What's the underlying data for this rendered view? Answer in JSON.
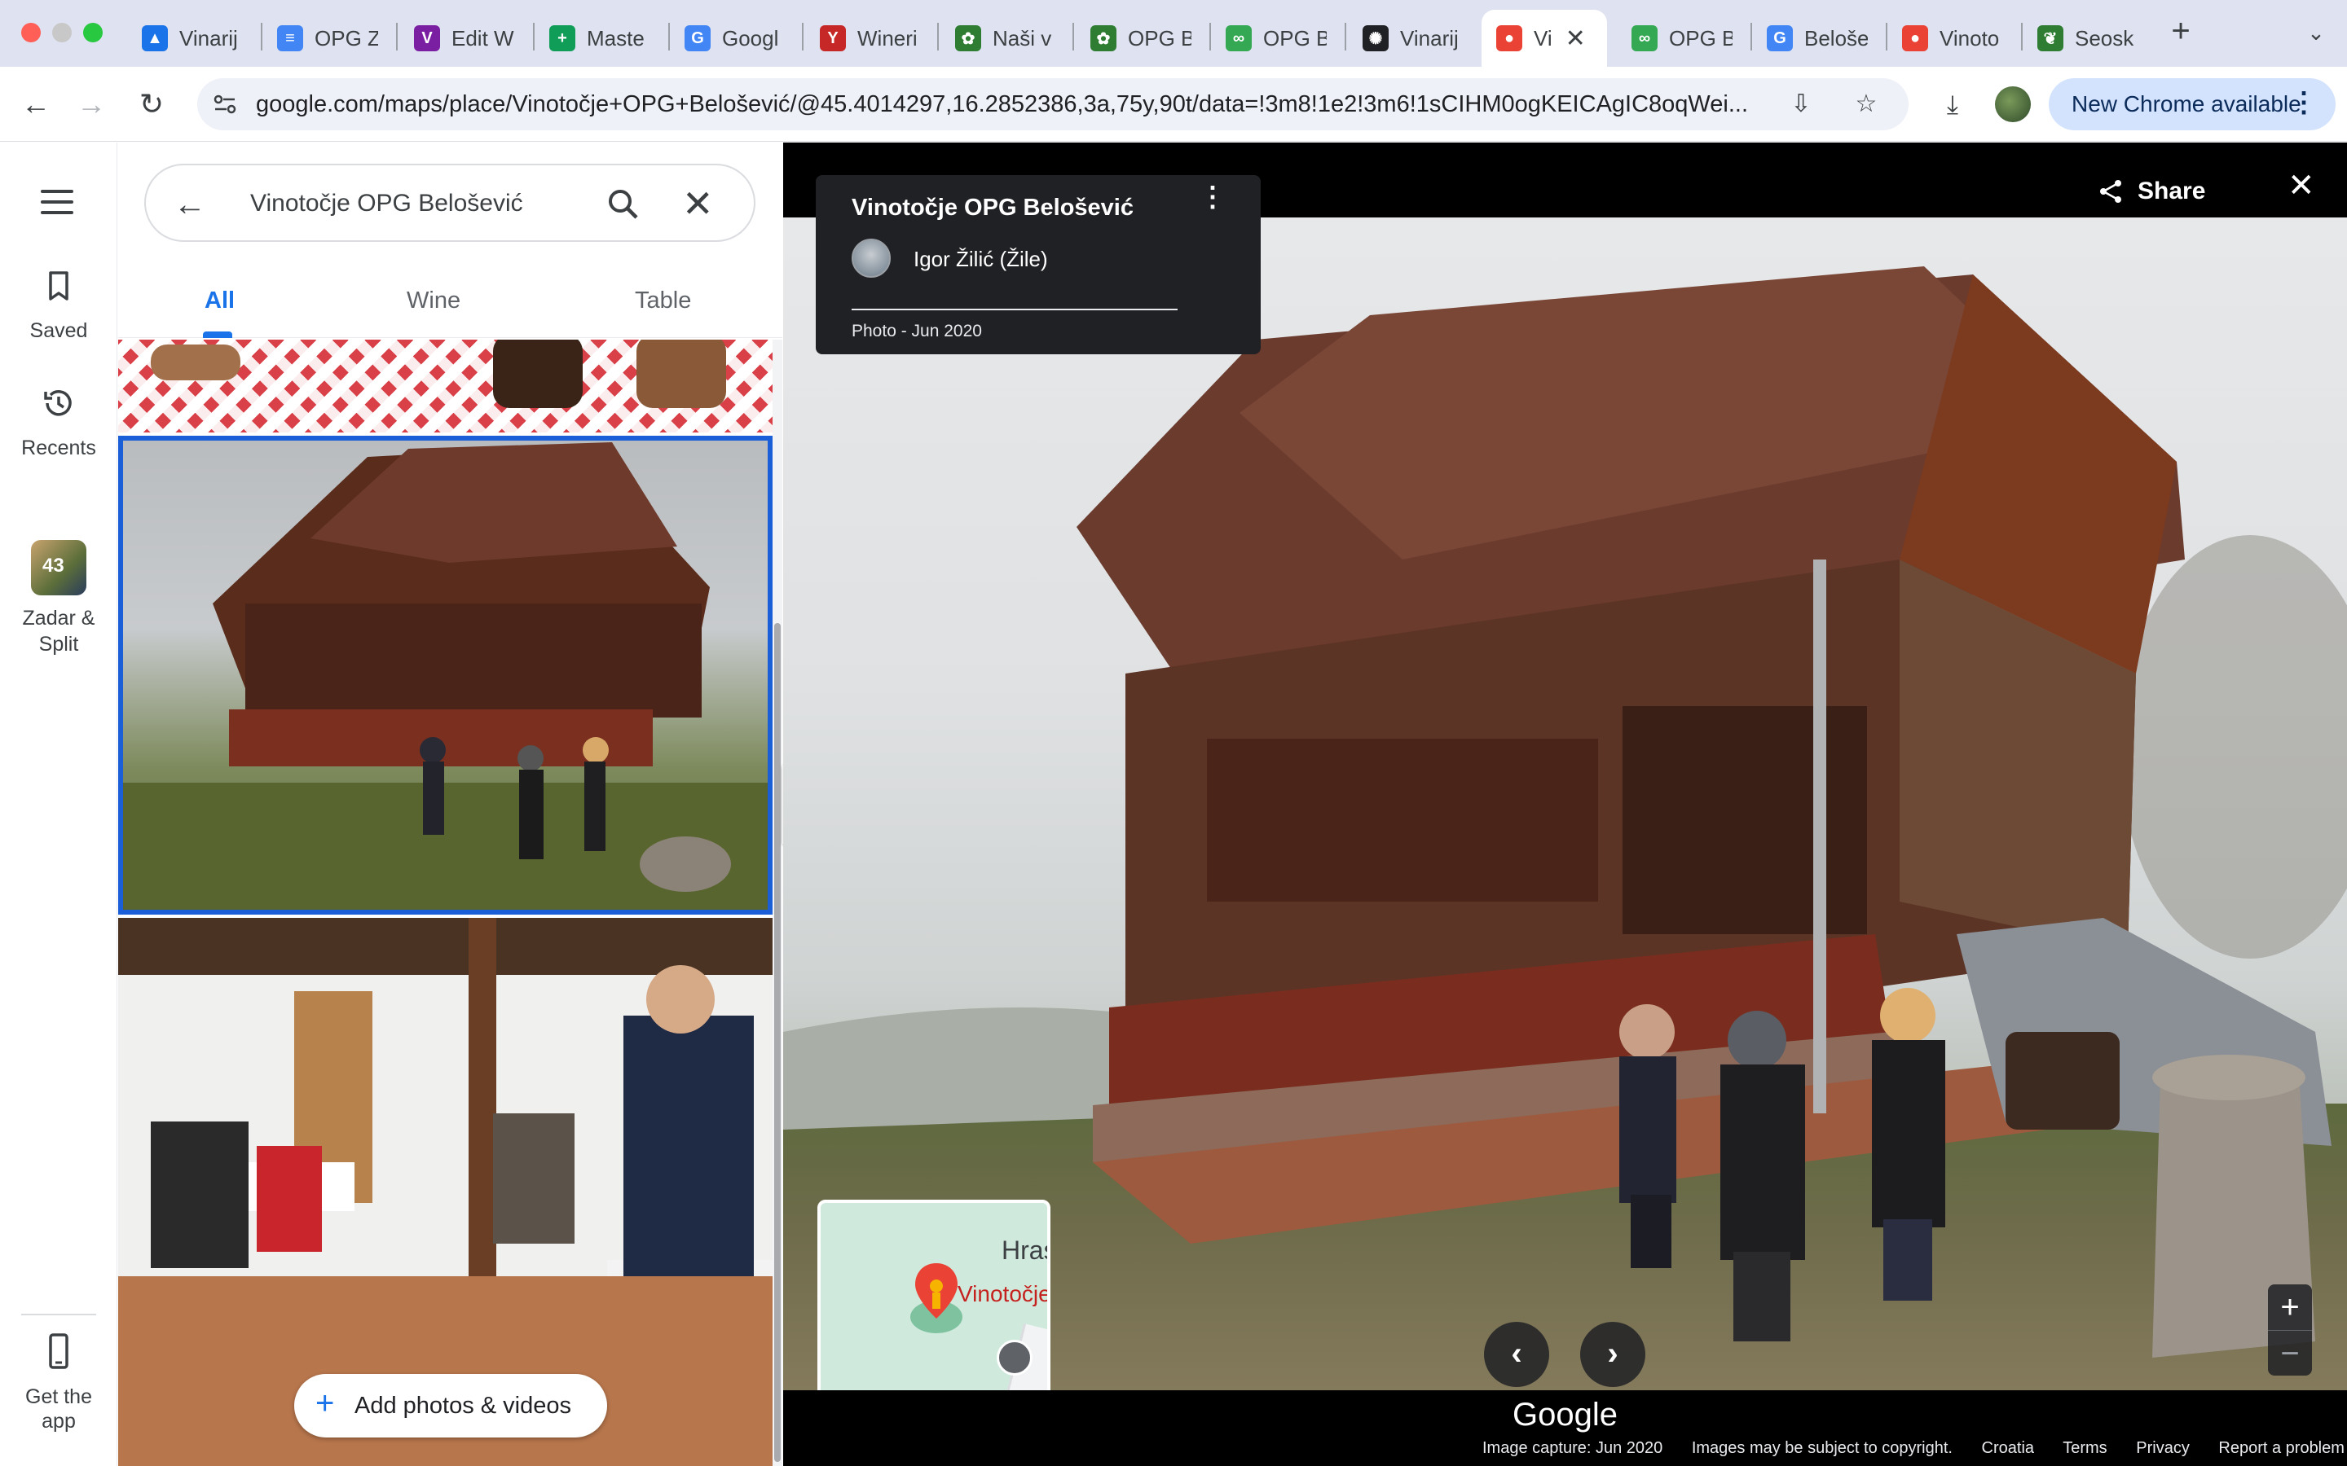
{
  "browser": {
    "tabs": [
      {
        "title": "Vinarij",
        "icon": "google-drive-icon",
        "color": "#1a73e8"
      },
      {
        "title": "OPG Z",
        "icon": "google-docs-icon",
        "color": "#4285f4"
      },
      {
        "title": "Edit W",
        "icon": "site-logo-icon",
        "color": "#7b1fa2"
      },
      {
        "title": "Maste",
        "icon": "google-sheets-icon",
        "color": "#0f9d58"
      },
      {
        "title": "Googl",
        "icon": "google-translate-icon",
        "color": "#4285f4"
      },
      {
        "title": "Wineri",
        "icon": "wine-glass-icon",
        "color": "#c62828"
      },
      {
        "title": "Naši v",
        "icon": "grape-icon",
        "color": "#2e7d32"
      },
      {
        "title": "OPG B",
        "icon": "grape-icon",
        "color": "#2e7d32"
      },
      {
        "title": "OPG B",
        "icon": "tripadvisor-icon",
        "color": "#34a853"
      },
      {
        "title": "Vinarij",
        "icon": "openai-icon",
        "color": "#202124"
      },
      {
        "title": "Vi",
        "icon": "google-maps-icon",
        "color": "#ea4335",
        "active": true
      },
      {
        "title": "OPG B",
        "icon": "tripadvisor-icon",
        "color": "#34a853"
      },
      {
        "title": "Belošev",
        "icon": "google-g-icon",
        "color": "#4285f4"
      },
      {
        "title": "Vinoto",
        "icon": "google-maps-icon",
        "color": "#ea4335"
      },
      {
        "title": "Seosk",
        "icon": "leaf-icon",
        "color": "#2e7d32"
      }
    ],
    "url": "google.com/maps/place/Vinotočje+OPG+Belošević/@45.4014297,16.2852386,3a,75y,90t/data=!3m8!1e2!3m6!1sCIHM0ogKEICAgIC8oqWei...",
    "update_label": "New Chrome available"
  },
  "rail": {
    "saved": "Saved",
    "recents": "Recents",
    "list_count": "43",
    "list_name": "Zadar & Split",
    "get_app": "Get the app"
  },
  "panel": {
    "query": "Vinotočje OPG Belošević",
    "tabs": [
      "All",
      "Wine",
      "Table"
    ],
    "add_photos": "Add photos & videos"
  },
  "viewer": {
    "title": "Vinotočje OPG Belošević",
    "author": "Igor Žilić (Žile)",
    "meta": "Photo - Jun 2020",
    "share": "Share",
    "minimap_town": "Hras",
    "minimap_place": "Vinotočje",
    "google": "Google",
    "footer": [
      "Image capture: Jun 2020",
      "Images may be subject to copyright.",
      "Croatia",
      "Terms",
      "Privacy",
      "Report a problem"
    ]
  }
}
